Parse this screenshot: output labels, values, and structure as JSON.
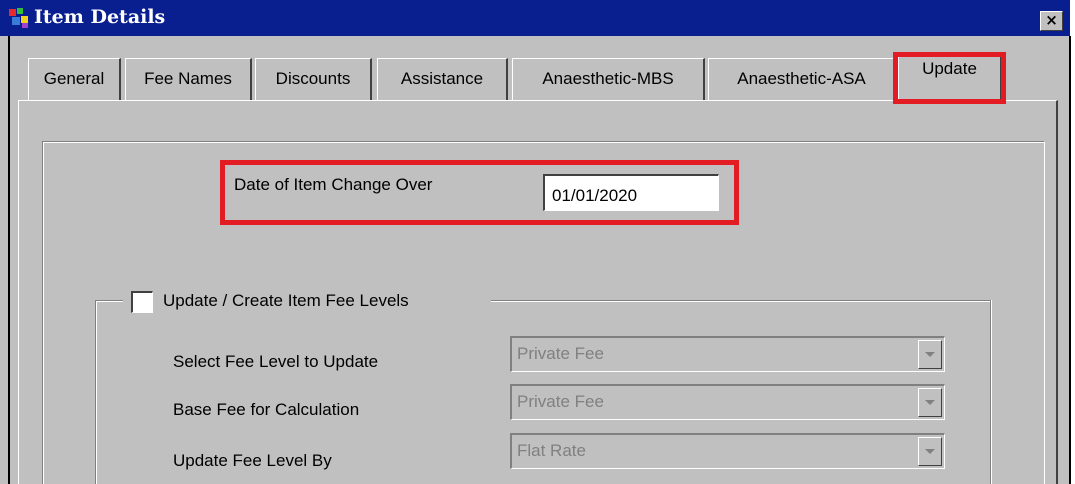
{
  "window": {
    "title": "Item Details",
    "close_label": "×"
  },
  "tabs": [
    {
      "label": "General"
    },
    {
      "label": "Fee Names"
    },
    {
      "label": "Discounts"
    },
    {
      "label": "Assistance"
    },
    {
      "label": "Anaesthetic-MBS"
    },
    {
      "label": "Anaesthetic-ASA"
    },
    {
      "label": "Update",
      "active": true
    }
  ],
  "update": {
    "date_label": "Date of Item Change Over",
    "date_value": "01/01/2020",
    "group": {
      "checkbox_label": "Update / Create Item Fee Levels",
      "checked": false,
      "rows": [
        {
          "label": "Select Fee Level to Update",
          "value": "Private Fee"
        },
        {
          "label": "Base Fee for Calculation",
          "value": "Private Fee"
        },
        {
          "label": "Update Fee Level By",
          "value": "Flat Rate"
        }
      ]
    }
  },
  "colors": {
    "titlebar": "#0a1f8f",
    "face": "#c0c0c0",
    "highlight": "#e31b23"
  },
  "icons": [
    "app-icon",
    "close-icon",
    "chevron-down-icon"
  ]
}
